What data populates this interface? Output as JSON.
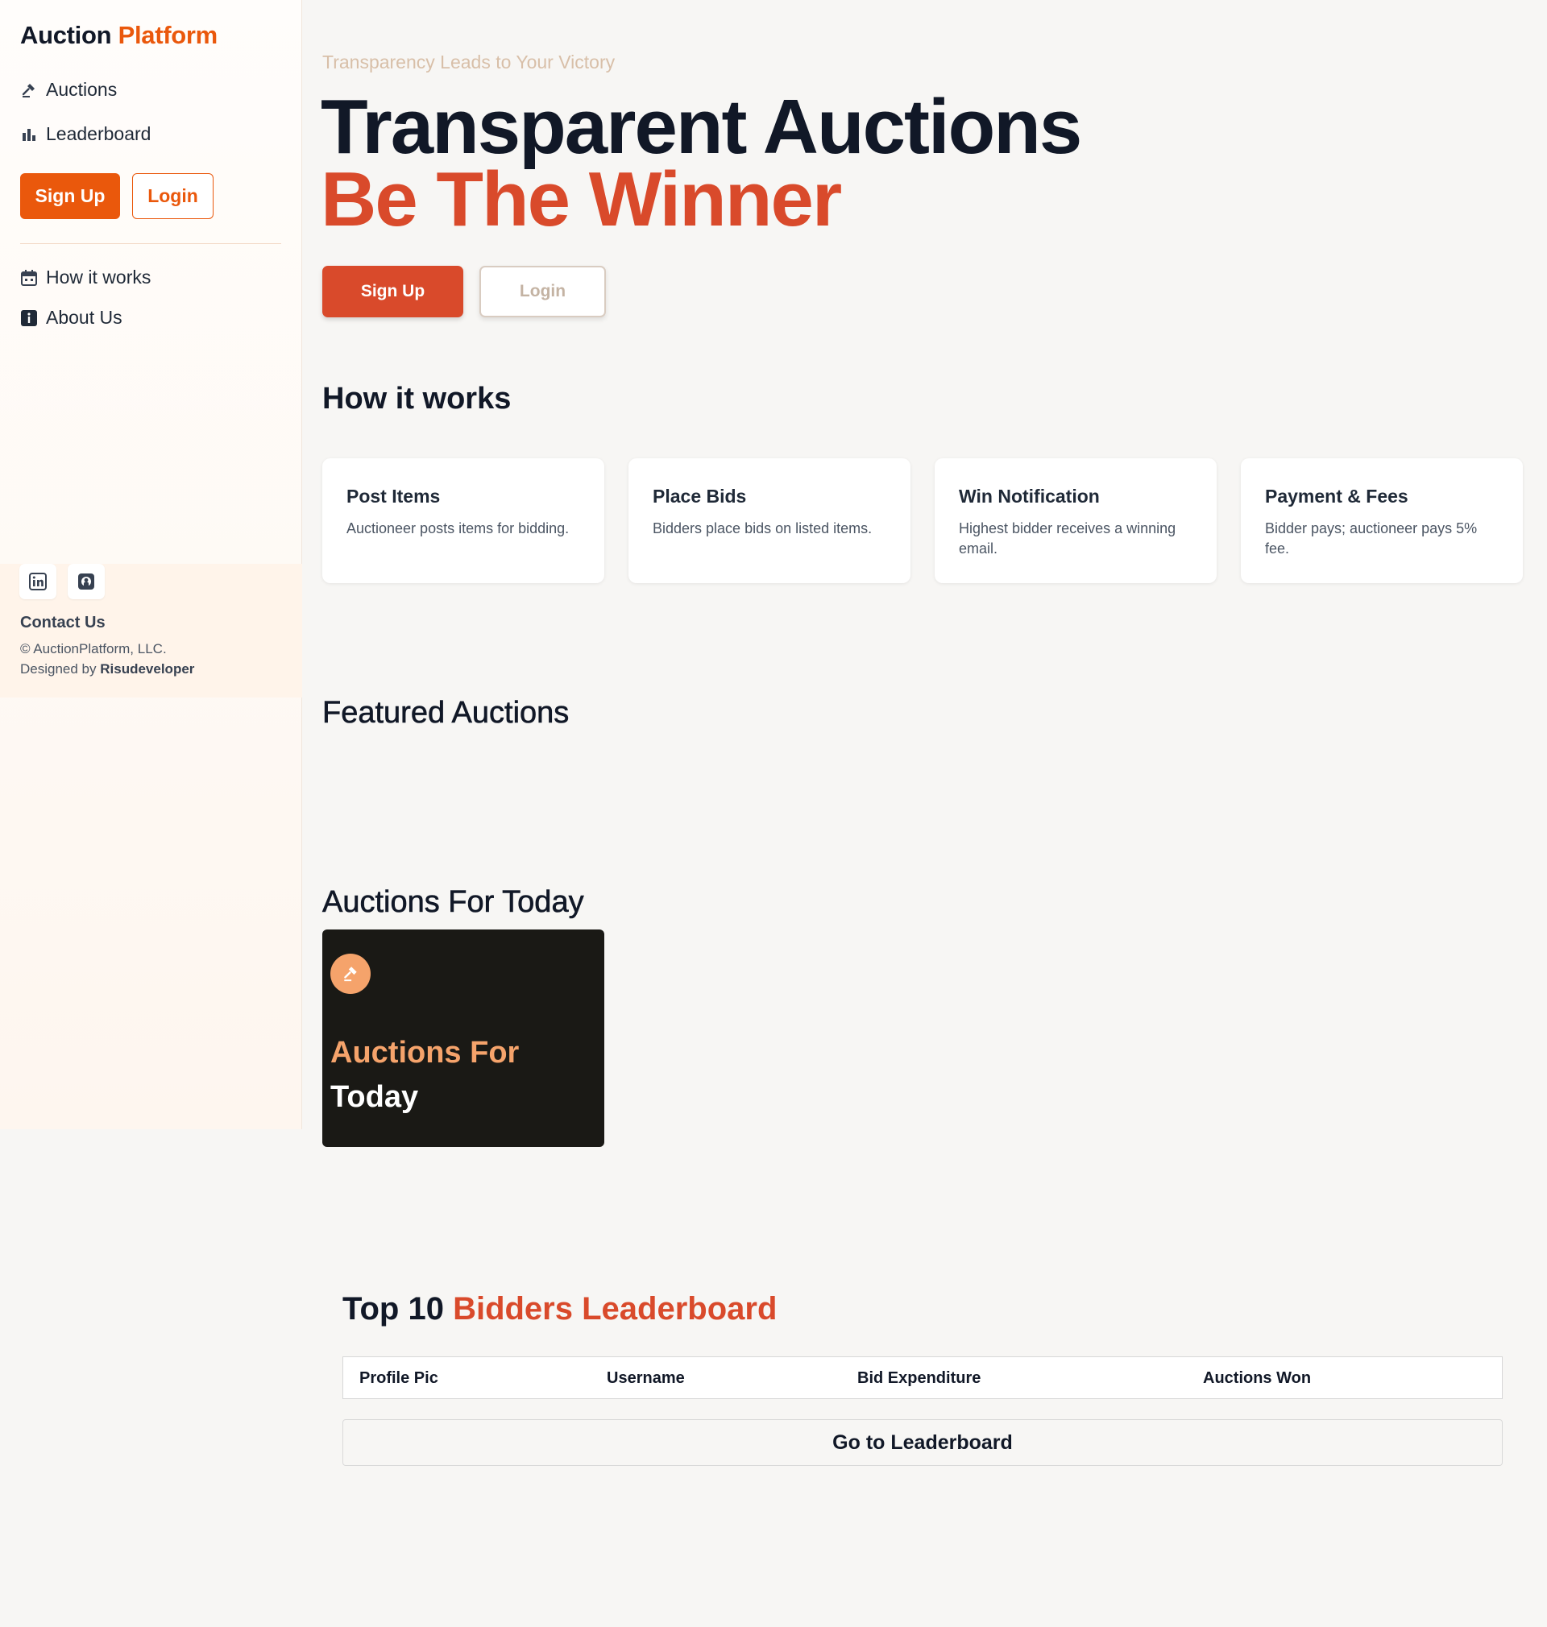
{
  "sidebar": {
    "brand": {
      "primary": "Auction",
      "accent": "Platform"
    },
    "nav": [
      {
        "label": "Auctions",
        "icon": "gavel-icon"
      },
      {
        "label": "Leaderboard",
        "icon": "bar-chart-icon"
      }
    ],
    "signup_label": "Sign Up",
    "login_label": "Login",
    "secondary_nav": [
      {
        "label": "How it works",
        "icon": "calendar-icon"
      },
      {
        "label": "About Us",
        "icon": "info-icon"
      }
    ],
    "social": [
      "linkedin-icon",
      "github-icon"
    ],
    "contact_label": "Contact Us",
    "copyright": "© AuctionPlatform, LLC.",
    "designed_prefix": "Designed by",
    "designer": "Risudeveloper"
  },
  "hero": {
    "tagline": "Transparency Leads to Your Victory",
    "line1": "Transparent Auctions",
    "line2": "Be The Winner",
    "signup_label": "Sign Up",
    "login_label": "Login"
  },
  "how_it_works": {
    "title": "How it works",
    "cards": [
      {
        "title": "Post Items",
        "desc": "Auctioneer posts items for bidding."
      },
      {
        "title": "Place Bids",
        "desc": "Bidders place bids on listed items."
      },
      {
        "title": "Win Notification",
        "desc": "Highest bidder receives a winning email."
      },
      {
        "title": "Payment & Fees",
        "desc": "Bidder pays; auctioneer pays 5% fee."
      }
    ]
  },
  "featured": {
    "title": "Featured Auctions"
  },
  "today": {
    "title": "Auctions For Today",
    "card_line1": "Auctions For",
    "card_line2": "Today"
  },
  "leaderboard": {
    "title_prefix": "Top 10",
    "title_accent": "Bidders Leaderboard",
    "columns": [
      "Profile Pic",
      "Username",
      "Bid Expenditure",
      "Auctions Won"
    ],
    "button_label": "Go to Leaderboard"
  },
  "colors": {
    "accent_orange": "#ea580c",
    "accent_red": "#d94a2b",
    "peach": "#f5a36b",
    "dark_card": "#1a1915"
  }
}
